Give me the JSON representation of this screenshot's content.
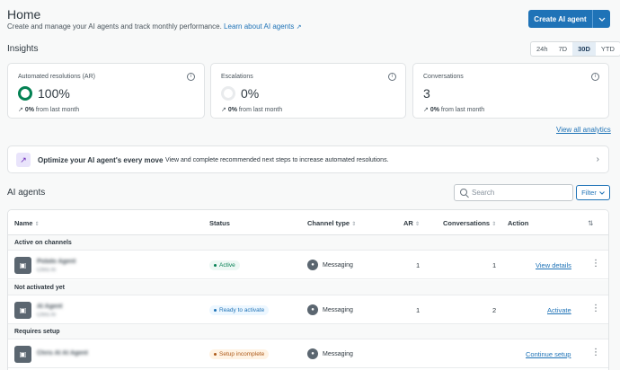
{
  "header": {
    "title": "Home",
    "subtitle": "Create and manage your AI agents and track monthly performance.",
    "learn_link": "Learn about AI agents",
    "create_button": "Create AI agent"
  },
  "insights": {
    "heading": "Insights",
    "ranges": [
      "24h",
      "7D",
      "30D",
      "YTD"
    ],
    "selected_range": "30D",
    "cards": [
      {
        "title": "Automated resolutions (AR)",
        "value": "100%",
        "ring_fill": 1.0,
        "trend_value": "0%",
        "trend_text": "from last month"
      },
      {
        "title": "Escalations",
        "value": "0%",
        "ring_fill": 0.0,
        "trend_value": "0%",
        "trend_text": "from last month"
      },
      {
        "title": "Conversations",
        "value": "3",
        "trend_value": "0%",
        "trend_text": "from last month"
      }
    ],
    "view_all": "View all analytics"
  },
  "banner": {
    "title": "Optimize your AI agent's every move",
    "text": "View and complete recommended next steps to increase automated resolutions."
  },
  "agents": {
    "heading": "AI agents",
    "search_placeholder": "Search",
    "filter_label": "Filter",
    "columns": {
      "name": "Name",
      "status": "Status",
      "channel": "Channel type",
      "ar": "AR",
      "conversations": "Conversations",
      "action": "Action"
    },
    "groups": [
      {
        "label": "Active on channels",
        "rows": [
          {
            "name": "Pobdo Agent",
            "subname": "Chris AI",
            "status": "Active",
            "status_color": "#037f52",
            "channel": "Messaging",
            "ar": "1",
            "conversations": "1",
            "action": "View details"
          }
        ]
      },
      {
        "label": "Not activated yet",
        "rows": [
          {
            "name": "AI Agent",
            "subname": "Chris AI",
            "status": "Ready to activate",
            "status_color": "#1f73b7",
            "channel": "Messaging",
            "ar": "1",
            "conversations": "2",
            "action": "Activate"
          }
        ]
      },
      {
        "label": "Requires setup",
        "rows": [
          {
            "name": "Chris AI AI Agent",
            "subname": "",
            "status": "Setup incomplete",
            "status_color": "#ad5918",
            "channel": "Messaging",
            "ar": "",
            "conversations": "",
            "action": "Continue setup"
          }
        ]
      }
    ]
  }
}
